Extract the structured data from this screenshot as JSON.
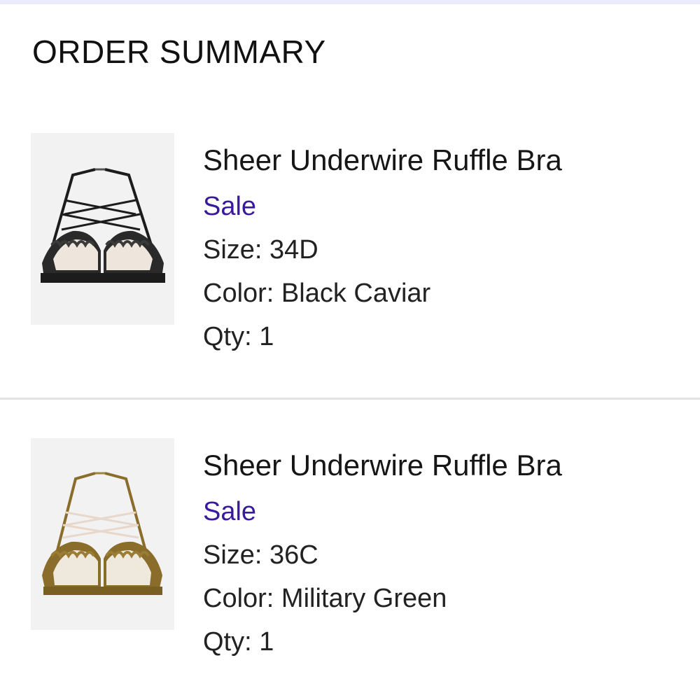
{
  "page": {
    "title": "ORDER SUMMARY",
    "accent_color": "#3a199d"
  },
  "items": [
    {
      "name": "Sheer Underwire Ruffle Bra",
      "badge": "Sale",
      "size": "Size: 34D",
      "color": "Color: Black Caviar",
      "qty": "Qty: 1",
      "image_icon": "black-bra-product-image",
      "swatch": "#1f1f1f"
    },
    {
      "name": "Sheer Underwire Ruffle Bra",
      "badge": "Sale",
      "size": "Size: 36C",
      "color": "Color: Military Green",
      "qty": "Qty: 1",
      "image_icon": "olive-bra-product-image",
      "swatch": "#8a6d2a"
    }
  ]
}
